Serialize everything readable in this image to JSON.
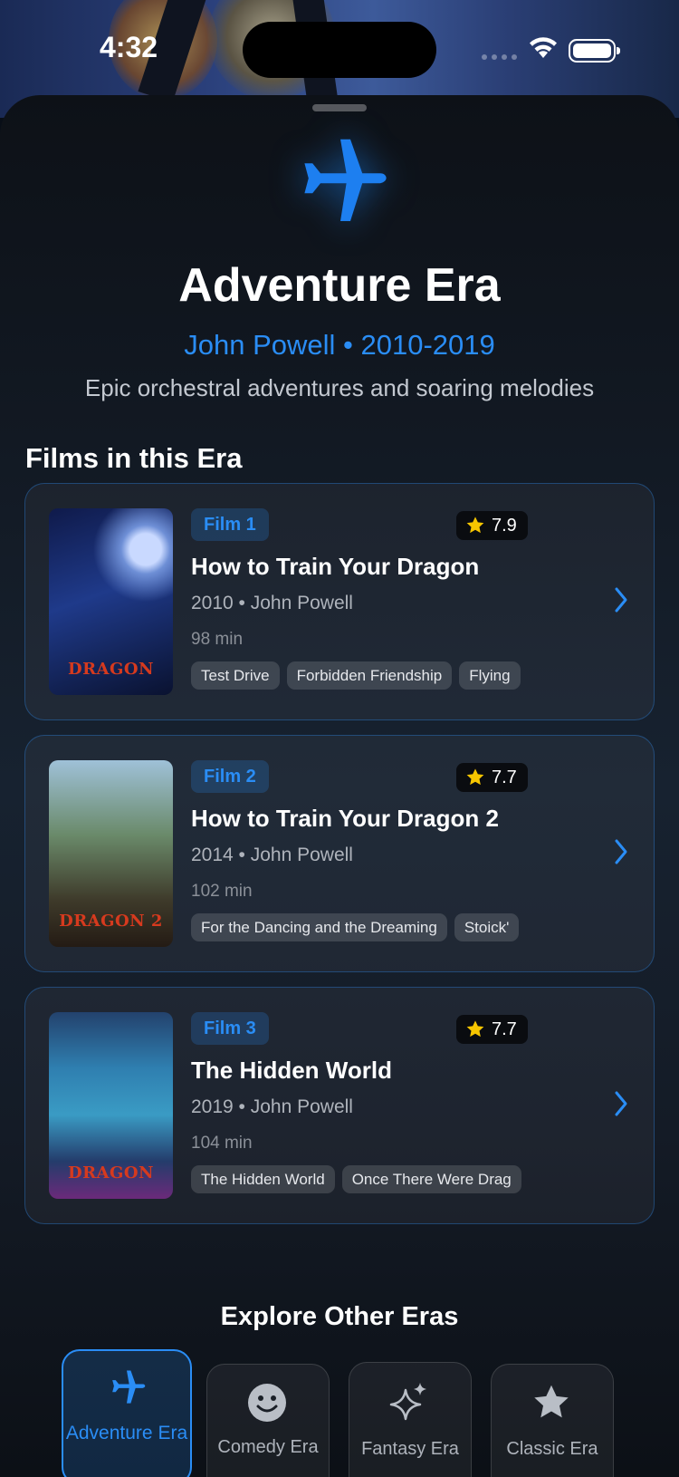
{
  "status_bar": {
    "time": "4:32"
  },
  "hero": {
    "icon": "airplane-icon",
    "title": "Adventure Era",
    "subtitle": "John Powell • 2010-2019",
    "description": "Epic orchestral adventures and soaring melodies"
  },
  "films_section": {
    "heading": "Films in this Era"
  },
  "films": [
    {
      "badge": "Film 1",
      "rating": "7.9",
      "title": "How to Train Your Dragon",
      "meta": "2010 • John Powell",
      "length": "98 min",
      "tags": [
        "Test Drive",
        "Forbidden Friendship",
        "Flying"
      ],
      "poster_caption": "DRAGON"
    },
    {
      "badge": "Film 2",
      "rating": "7.7",
      "title": "How to Train Your Dragon 2",
      "meta": "2014 • John Powell",
      "length": "102 min",
      "tags": [
        "For the Dancing and the Dreaming",
        "Stoick'"
      ],
      "poster_caption": "DRAGON 2"
    },
    {
      "badge": "Film 3",
      "rating": "7.7",
      "title": "The Hidden World",
      "meta": "2019 • John Powell",
      "length": "104 min",
      "tags": [
        "The Hidden World",
        "Once There Were Drag"
      ],
      "poster_caption": "DRAGON"
    }
  ],
  "explore": {
    "heading": "Explore Other Eras",
    "eras": [
      {
        "label": "Adventure Era",
        "icon": "airplane-icon",
        "active": true
      },
      {
        "label": "Comedy Era",
        "icon": "smiley-face-icon",
        "active": false
      },
      {
        "label": "Fantasy Era",
        "icon": "sparkles-icon",
        "active": false
      },
      {
        "label": "Classic Era",
        "icon": "star-icon",
        "active": false
      }
    ]
  },
  "colors": {
    "accent": "#2a8df5",
    "star": "#f7c600",
    "background": "#0d1117"
  }
}
